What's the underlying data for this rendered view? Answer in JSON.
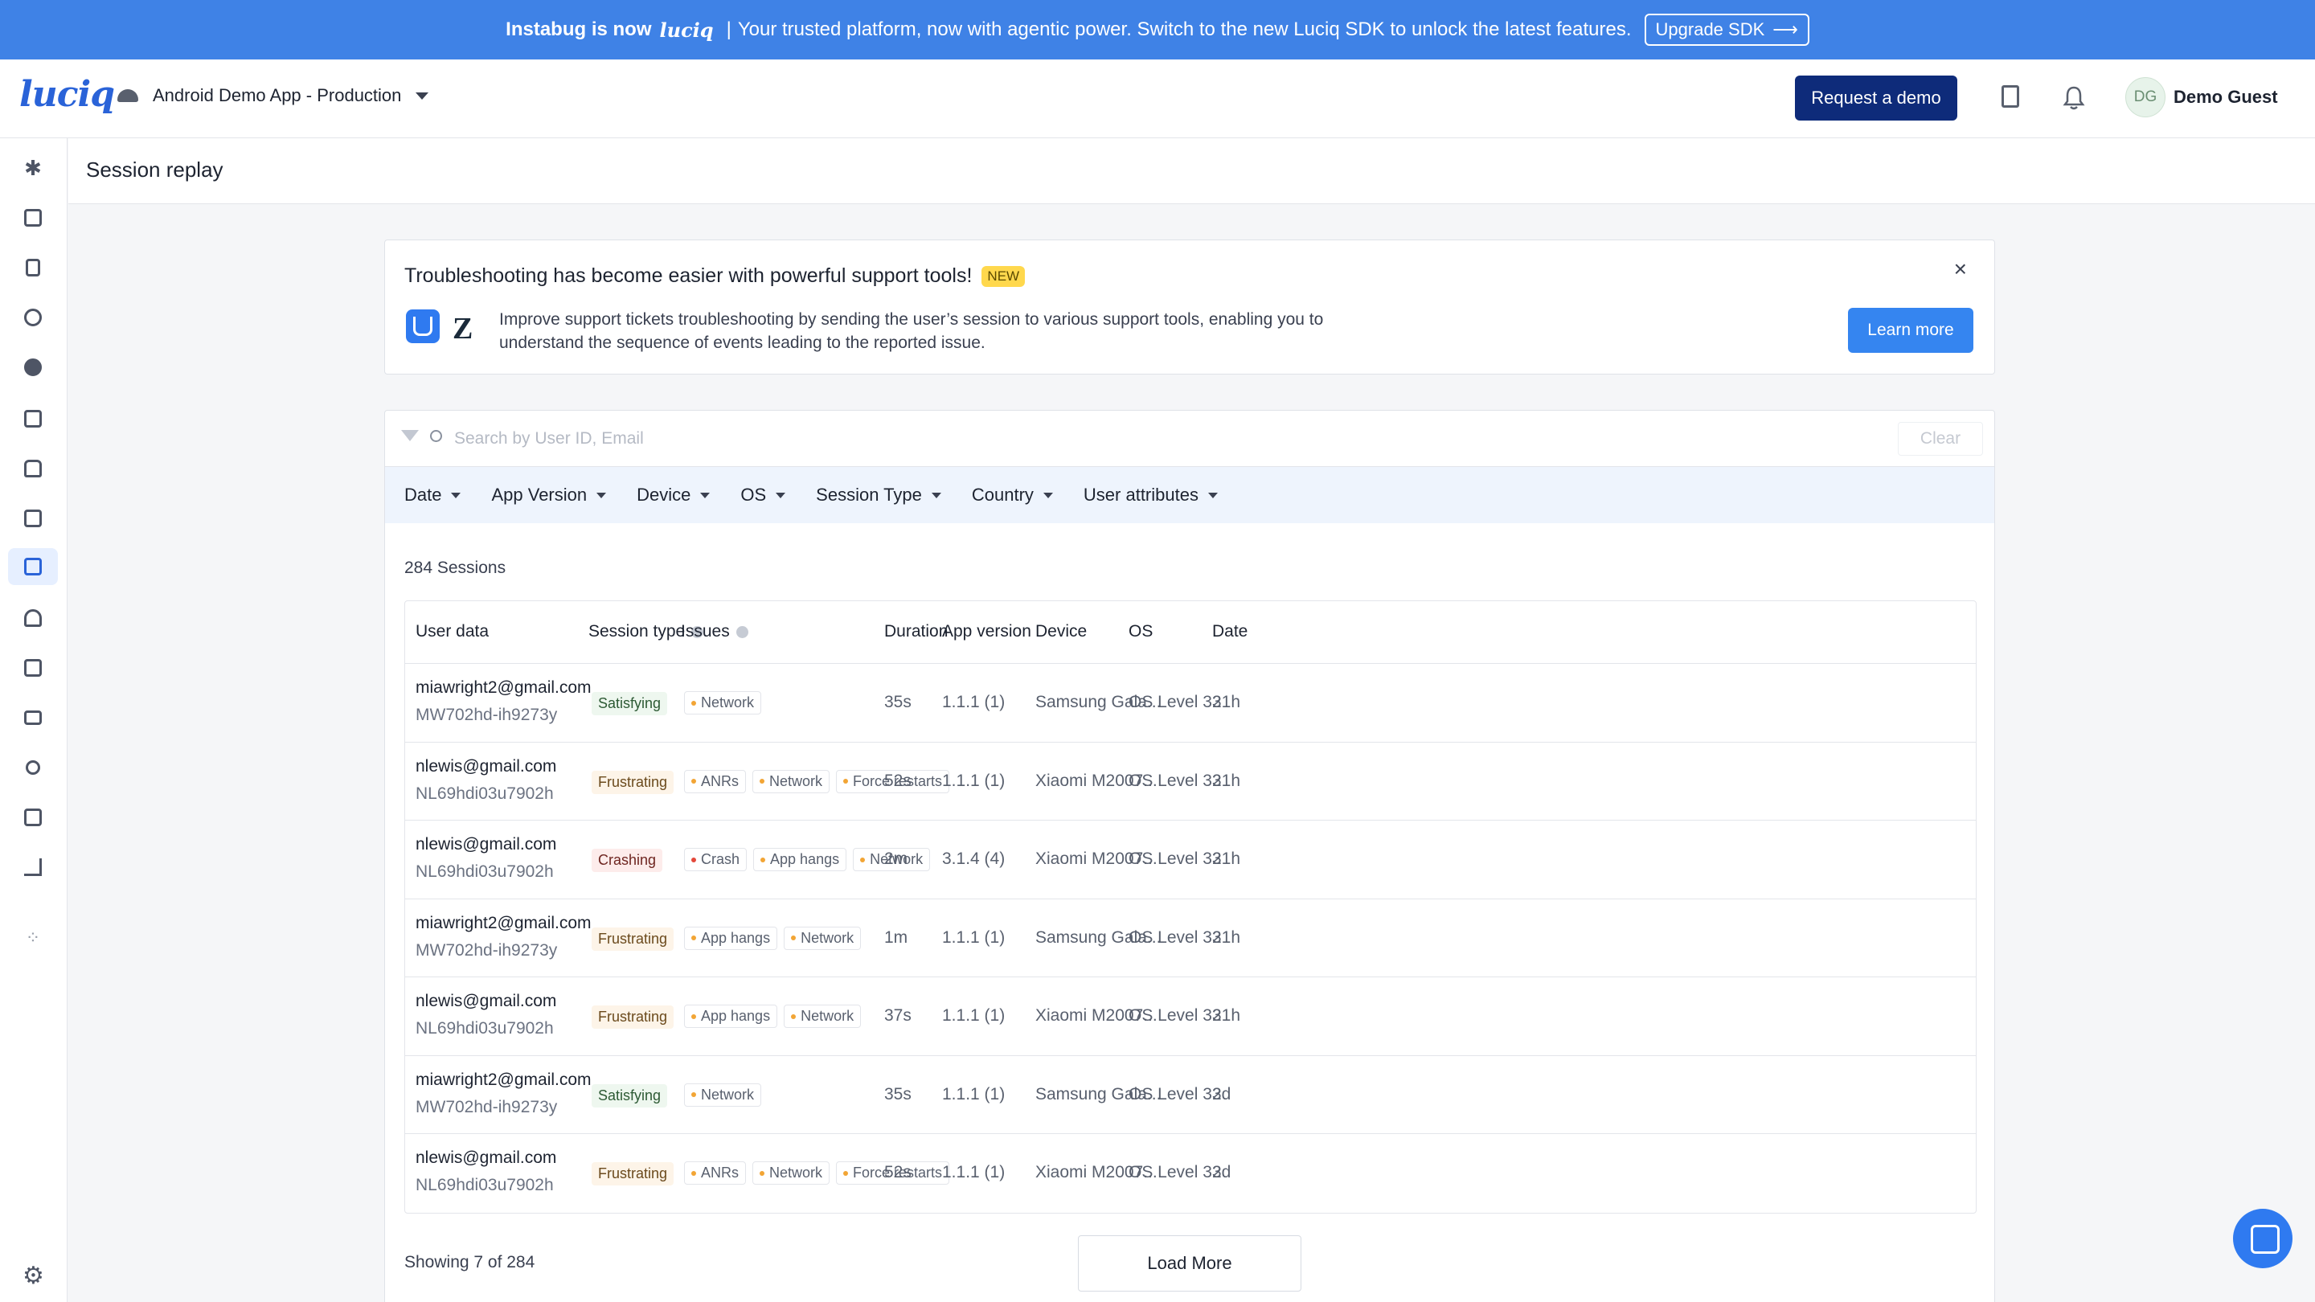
{
  "announcement": {
    "brand": "Instabug is now",
    "logo": "luciq",
    "separator": "|",
    "message": "Your trusted platform, now with agentic power. Switch to the new Luciq SDK to unlock the latest features.",
    "button": "Upgrade SDK",
    "arrow": "⟶",
    "bg_color": "#3f82e6"
  },
  "header": {
    "logo": "luciq",
    "app_name": "Android Demo App - Production",
    "request_demo": "Request a demo",
    "avatar_initials": "DG",
    "user_name": "Demo Guest",
    "brand_color": "#0e2b7a"
  },
  "sidebar": {
    "items": [
      "pin-icon",
      "dashboard-icon",
      "device-icon",
      "bug-icon",
      "alert-icon",
      "bolt-icon",
      "network-icon",
      "screenshot-icon",
      "session-replay-icon",
      "crown-icon",
      "survey-icon",
      "storage-icon",
      "users-icon",
      "list-icon",
      "analytics-icon",
      "apps-grid-icon"
    ],
    "settings": "gear-icon",
    "glyphs": {
      "pin": "✱",
      "apps": "⁘",
      "gear": "⚙"
    }
  },
  "page": {
    "title": "Session replay"
  },
  "promo": {
    "title": "Troubleshooting has become easier with powerful support tools!",
    "badge": "NEW",
    "description": "Improve support tickets troubleshooting by sending the user’s session to various support tools, enabling you to understand the sequence of events leading to the reported issue.",
    "learn_more": "Learn more",
    "close": "×",
    "zendesk_glyph": "Z"
  },
  "sessions": {
    "search_placeholder": "Search by User ID, Email",
    "clear": "Clear",
    "filters": [
      "Date",
      "App Version",
      "Device",
      "OS",
      "Session Type",
      "Country",
      "User attributes"
    ],
    "count": "284 Sessions",
    "columns": [
      "User data",
      "Session type",
      "Issues",
      "Duration",
      "App version",
      "Device",
      "OS",
      "Date"
    ],
    "rows": [
      {
        "email": "miawright2@gmail.com",
        "uid": "MW702hd-ih9273y",
        "type": "Satisfying",
        "issues": [
          "Network"
        ],
        "duration": "35s",
        "version": "1.1.1 (1)",
        "device": "Samsung Gala...",
        "os": "OS Level 33",
        "date": "21h"
      },
      {
        "email": "nlewis@gmail.com",
        "uid": "NL69hdi03u7902h",
        "type": "Frustrating",
        "issues": [
          "ANRs",
          "Network",
          "Force restarts"
        ],
        "duration": "52s",
        "version": "1.1.1 (1)",
        "device": "Xiaomi M2007...",
        "os": "OS Level 33",
        "date": "21h"
      },
      {
        "email": "nlewis@gmail.com",
        "uid": "NL69hdi03u7902h",
        "type": "Crashing",
        "issues": [
          "Crash",
          "App hangs",
          "Network"
        ],
        "duration": "2m",
        "version": "3.1.4 (4)",
        "device": "Xiaomi M2007...",
        "os": "OS Level 33",
        "date": "21h"
      },
      {
        "email": "miawright2@gmail.com",
        "uid": "MW702hd-ih9273y",
        "type": "Frustrating",
        "issues": [
          "App hangs",
          "Network"
        ],
        "duration": "1m",
        "version": "1.1.1 (1)",
        "device": "Samsung Gala...",
        "os": "OS Level 33",
        "date": "21h"
      },
      {
        "email": "nlewis@gmail.com",
        "uid": "NL69hdi03u7902h",
        "type": "Frustrating",
        "issues": [
          "App hangs",
          "Network"
        ],
        "duration": "37s",
        "version": "1.1.1 (1)",
        "device": "Xiaomi M2007...",
        "os": "OS Level 33",
        "date": "21h"
      },
      {
        "email": "miawright2@gmail.com",
        "uid": "MW702hd-ih9273y",
        "type": "Satisfying",
        "issues": [
          "Network"
        ],
        "duration": "35s",
        "version": "1.1.1 (1)",
        "device": "Samsung Gala...",
        "os": "OS Level 33",
        "date": "2d"
      },
      {
        "email": "nlewis@gmail.com",
        "uid": "NL69hdi03u7902h",
        "type": "Frustrating",
        "issues": [
          "ANRs",
          "Network",
          "Force restarts"
        ],
        "duration": "52s",
        "version": "1.1.1 (1)",
        "device": "Xiaomi M2007...",
        "os": "OS Level 33",
        "date": "2d"
      }
    ],
    "showing": "Showing 7 of 284",
    "load_more": "Load More"
  }
}
